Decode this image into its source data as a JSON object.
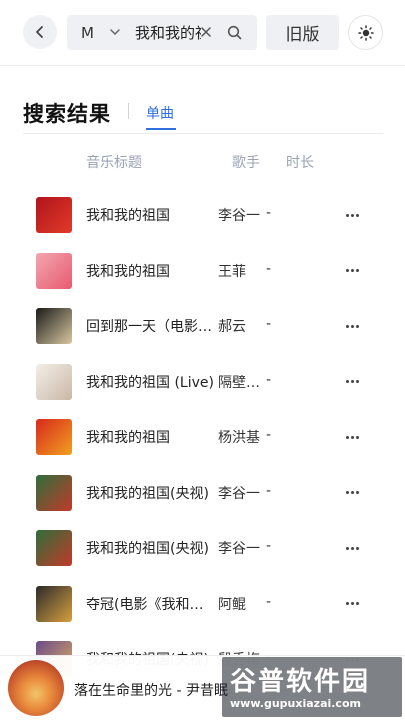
{
  "topbar": {
    "scope": "M",
    "search_value": "我和我的祖国",
    "old_version_label": "旧版"
  },
  "header": {
    "title": "搜索结果",
    "active_tab": "单曲"
  },
  "columns": {
    "title": "音乐标题",
    "artist": "歌手",
    "duration": "时长"
  },
  "songs": [
    {
      "title": "我和我的祖国",
      "artist": "李谷一",
      "duration": "-",
      "cover_colors": [
        "#b0141a",
        "#e03a2a"
      ]
    },
    {
      "title": "我和我的祖国",
      "artist": "王菲",
      "duration": "-",
      "cover_colors": [
        "#f2a6b0",
        "#e85a6e"
      ]
    },
    {
      "title": "回到那一天（电影《我和我的祖国》",
      "artist": "郝云",
      "duration": "-",
      "cover_colors": [
        "#1a1a1a",
        "#d8c8a0"
      ]
    },
    {
      "title": "我和我的祖国 (Live)",
      "artist": "隔壁老樊",
      "duration": "-",
      "cover_colors": [
        "#f3eee8",
        "#c9b8a6"
      ]
    },
    {
      "title": "我和我的祖国",
      "artist": "杨洪基",
      "duration": "-",
      "cover_colors": [
        "#d8281c",
        "#f0a020"
      ]
    },
    {
      "title": "我和我的祖国(央视)",
      "artist": "李谷一",
      "duration": "-",
      "cover_colors": [
        "#2e6e3a",
        "#c23a2a"
      ]
    },
    {
      "title": "我和我的祖国(央视)",
      "artist": "李谷一",
      "duration": "-",
      "cover_colors": [
        "#2e6e3a",
        "#c23a2a"
      ]
    },
    {
      "title": "夺冠(电影《我和我的祖国》",
      "artist": "阿鲲",
      "duration": "-",
      "cover_colors": [
        "#2a2a2a",
        "#d8a040"
      ]
    },
    {
      "title": "我和我的祖国(央视)",
      "artist": "殷秀梅",
      "duration": "-",
      "cover_colors": [
        "#6a4a8a",
        "#e0b060"
      ]
    }
  ],
  "player": {
    "now_playing": "落在生命里的光 - 尹昔眠"
  },
  "watermark": {
    "title": "谷普软件园",
    "url": "www.gupuxiazai.com"
  },
  "colors": {
    "accent": "#2f6fe0",
    "muted_text": "#9aa3b5",
    "control_bg": "#eef0f3"
  }
}
